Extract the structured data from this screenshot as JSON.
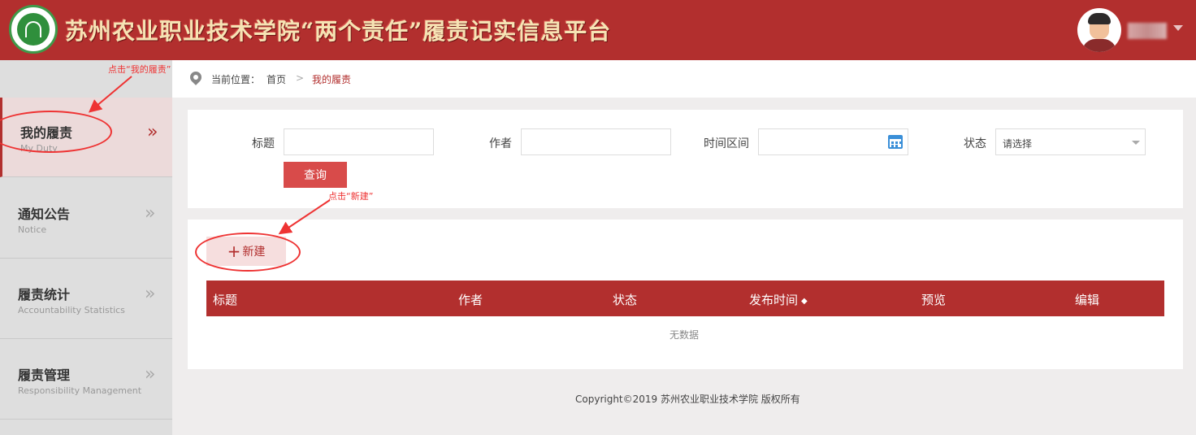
{
  "header": {
    "title": "苏州农业职业技术学院“两个责任”履责记实信息平台"
  },
  "colors": {
    "brand": "#b22f2e",
    "button": "#d84b4a",
    "new_button_bg": "#f6dede"
  },
  "sidebar": {
    "items": [
      {
        "cn": "我的履责",
        "en": "My Duty",
        "active": true
      },
      {
        "cn": "通知公告",
        "en": "Notice",
        "active": false
      },
      {
        "cn": "履责统计",
        "en": "Accountability Statistics",
        "active": false
      },
      {
        "cn": "履责管理",
        "en": "Responsibility Management",
        "active": false
      }
    ],
    "chevron": "»"
  },
  "breadcrumb": {
    "prefix": "当前位置：",
    "home": "首页",
    "separator": ">",
    "current": "我的履责"
  },
  "search": {
    "title_label": "标题",
    "author_label": "作者",
    "time_label": "时间区间",
    "status_label": "状态",
    "status_placeholder": "请选择",
    "query_button": "查询"
  },
  "toolbar": {
    "new_plus": "+",
    "new_label": "新建"
  },
  "table": {
    "columns": [
      "标题",
      "作者",
      "状态",
      "发布时间",
      "预览",
      "编辑"
    ],
    "sort_icon": "◆",
    "empty_text": "无数据"
  },
  "footer": {
    "copyright": "Copyright©2019 苏州农业职业技术学院 版权所有"
  },
  "annotations": {
    "click_my_duty": "点击“我的履责”",
    "click_new": "点击“新建”"
  }
}
